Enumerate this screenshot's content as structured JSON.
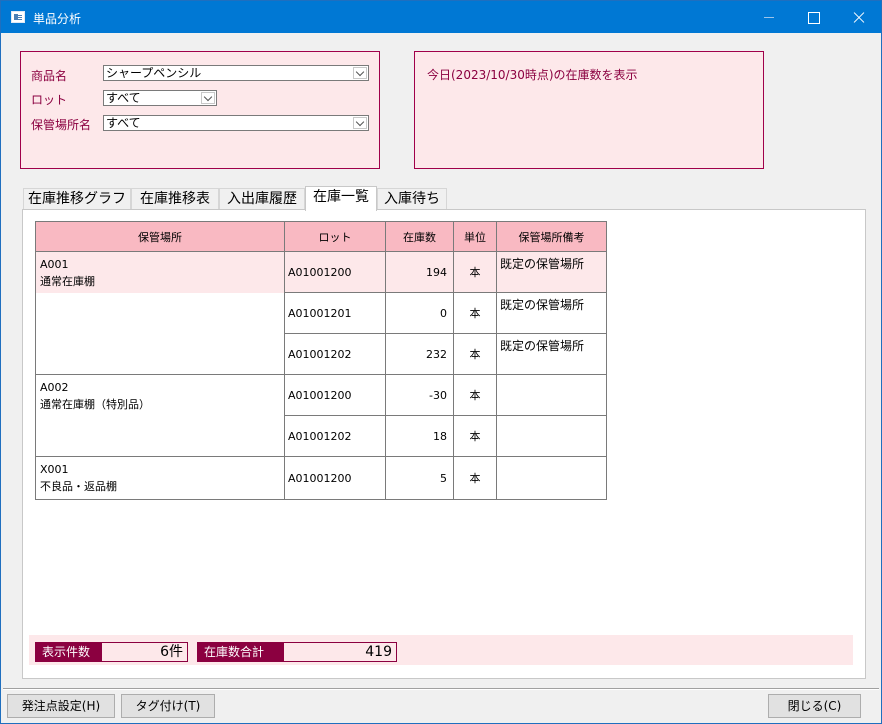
{
  "window": {
    "title": "単品分析"
  },
  "filters": {
    "product_label": "商品名",
    "product_value": "シャープペンシル",
    "lot_label": "ロット",
    "lot_value": "すべて",
    "location_label": "保管場所名",
    "location_value": "すべて"
  },
  "info": {
    "text": "今日(2023/10/30時点)の在庫数を表示"
  },
  "tabs": [
    {
      "label": "在庫推移グラフ",
      "active": false
    },
    {
      "label": "在庫推移表",
      "active": false
    },
    {
      "label": "入出庫履歴",
      "active": false
    },
    {
      "label": "在庫一覧",
      "active": true
    },
    {
      "label": "入庫待ち",
      "active": false
    }
  ],
  "table": {
    "columns": [
      "保管場所",
      "ロット",
      "在庫数",
      "単位",
      "保管場所備考"
    ],
    "groups": [
      {
        "code": "A001",
        "name": "通常在庫棚",
        "rows": [
          {
            "lot": "A01001200",
            "qty": "194",
            "unit": "本",
            "note": "既定の保管場所"
          },
          {
            "lot": "A01001201",
            "qty": "0",
            "unit": "本",
            "note": "既定の保管場所"
          },
          {
            "lot": "A01001202",
            "qty": "232",
            "unit": "本",
            "note": "既定の保管場所"
          }
        ]
      },
      {
        "code": "A002",
        "name": "通常在庫棚（特別品）",
        "rows": [
          {
            "lot": "A01001200",
            "qty": "-30",
            "unit": "本",
            "note": ""
          },
          {
            "lot": "A01001202",
            "qty": "18",
            "unit": "本",
            "note": ""
          }
        ]
      },
      {
        "code": "X001",
        "name": "不良品・返品棚",
        "rows": [
          {
            "lot": "A01001200",
            "qty": "5",
            "unit": "本",
            "note": ""
          }
        ]
      }
    ]
  },
  "summary": {
    "count_label": "表示件数",
    "count_value": "6件",
    "total_label": "在庫数合計",
    "total_value": "419"
  },
  "buttons": {
    "order_point": "発注点設定(H)",
    "tagging": "タグ付け(T)",
    "close": "閉じる(C)"
  },
  "colors": {
    "titlebar": "#0078d4",
    "accent": "#8b0040",
    "panel_bg": "#fde8ea",
    "header_bg": "#f9b9c2"
  }
}
